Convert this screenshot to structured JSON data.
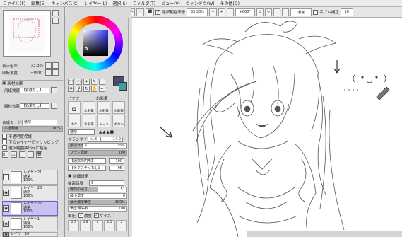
{
  "menu": [
    "ファイル(F)",
    "編集(E)",
    "キャンバス(C)",
    "レイヤー(L)",
    "選択(S)",
    "フィルタ(T)",
    "ビュー(V)",
    "ウィンドウ(W)",
    "その他(O)"
  ],
  "toolbar": {
    "selection_display": "選択範囲表示",
    "zoom": "33.33%",
    "rotation": "+000°",
    "blend_mode": "通常",
    "stabilizer_label": "手ブレ補正",
    "stabilizer_value": "10"
  },
  "navigator": {
    "zoom_label": "表示倍率",
    "zoom_value": "33.3%",
    "rotation_label": "回転角度",
    "rotation_value": "+000°"
  },
  "paper": {
    "header": "画材効果",
    "texture_label": "用紙質感",
    "texture_value": "【質感なし】",
    "effect_label": "画材効果",
    "effect_value": "【効果なし】"
  },
  "layer_props": {
    "mode_label": "合成モード",
    "mode_value": "通常",
    "opacity_label": "不透明度",
    "opacity_value": "100%",
    "protect_alpha": "不透明度保護",
    "clip_group": "下のレイヤーでクリッピング",
    "sample_source": "選択範囲抽出元に指定"
  },
  "layers": [
    {
      "name": "レイヤー21",
      "mode": "通常",
      "opacity": "100%",
      "visible": false,
      "selected": false
    },
    {
      "name": "レイヤー23",
      "mode": "通常",
      "opacity": "100%",
      "visible": true,
      "selected": false
    },
    {
      "name": "レイヤー22",
      "mode": "通常",
      "opacity": "100%",
      "visible": true,
      "selected": true
    },
    {
      "name": "レイヤー1",
      "mode": "通常",
      "opacity": "100%",
      "visible": true,
      "selected": false
    },
    {
      "name": "レイヤー16",
      "mode": "",
      "opacity": "",
      "visible": true,
      "selected": false
    }
  ],
  "brushes": {
    "header_left": "パケツ",
    "header_right": "水彩筆",
    "cells": [
      "水彩筆",
      "水彩筆",
      "水彩筆",
      "水彩筆",
      "水彩筆",
      "水彩筆",
      "カケ",
      "トーン",
      "ボカシ"
    ]
  },
  "brush_settings": {
    "mode": "通常",
    "size_label": "ブラシサイズ",
    "size_mult": "x1.0",
    "size_value": "14.0",
    "min_size_label": "最小サイズ",
    "min_size_value": "25%",
    "min_size_fraction": 0.25,
    "density_label": "ブラシ濃度",
    "density_value": "100",
    "density_fraction": 1.0,
    "shape_value": "【通常の円形】",
    "shape_strength": "100",
    "texture_value": "【テクスチャなし】",
    "texture_strength": "95",
    "detail_header": "詳細設定",
    "quality_label": "描画品質",
    "quality_value": "3",
    "edge_label": "輪郭の硬さ",
    "edge_value": "51",
    "edge_fraction": 0.51,
    "min_density_label": "最小濃度",
    "min_density_value": "0",
    "max_density_pressure_label": "最大濃度筆圧",
    "max_density_pressure_value": "100%",
    "pressure_hard_label": "筆圧 硬⇔軟",
    "pressure_hard_value": "100",
    "pressure_label": "筆圧:",
    "pressure_density": "濃度",
    "pressure_size": "サイズ",
    "size_presets": [
      "0.7",
      "0.8",
      "1",
      "1.5",
      "2"
    ]
  },
  "colors": {
    "accent": "#7a6fd6",
    "primary_swatch": "#4a4a6a",
    "secondary_swatch": "#3e9e9e"
  },
  "icons": [
    "new-layer-icon",
    "new-folder-icon",
    "delete-layer-icon",
    "eye-icon",
    "move-icon",
    "zoom-icon",
    "rotate-icon",
    "hand-icon",
    "eyedropper-icon",
    "marquee-icon",
    "lasso-icon",
    "magic-wand-icon"
  ]
}
